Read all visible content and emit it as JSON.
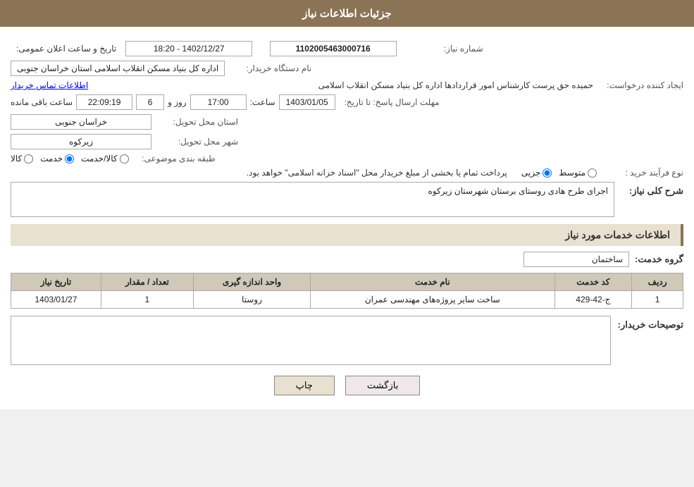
{
  "header": {
    "title": "جزئیات اطلاعات نیاز"
  },
  "info": {
    "need_number_label": "شماره نیاز:",
    "need_number_value": "1102005463000716",
    "announcement_label": "تاریخ و ساعت اعلان عمومی:",
    "announcement_value": "1402/12/27 - 18:20",
    "buyer_org_label": "نام دستگاه خریدار:",
    "buyer_org_value": "اداره کل بنیاد مسکن انقلاب اسلامی استان خراسان جنوبی",
    "creator_label": "ایجاد کننده درخواست:",
    "creator_value": "حمیده حق پرست کارشناس امور قراردادها اداره کل بنیاد مسکن انقلاب اسلامی",
    "contact_link": "اطلاعات تماس خریدار",
    "deadline_label": "مهلت ارسال پاسخ: تا تاریخ:",
    "deadline_date": "1403/01/05",
    "deadline_time_label": "ساعت:",
    "deadline_time": "17:00",
    "deadline_days_label": "روز و",
    "deadline_days": "6",
    "deadline_remaining_label": "ساعت باقی مانده",
    "deadline_remaining": "22:09:19",
    "province_label": "استان محل تحویل:",
    "province_value": "خراسان جنوبی",
    "city_label": "شهر محل تحویل:",
    "city_value": "زیرکوه",
    "category_label": "طبقه بندی موضوعی:",
    "category_options": [
      {
        "label": "کالا",
        "value": "kala"
      },
      {
        "label": "خدمت",
        "value": "khedmat"
      },
      {
        "label": "کالا/خدمت",
        "value": "kala_khedmat"
      }
    ],
    "category_selected": "khedmat",
    "purchase_type_label": "نوع فرآیند خرید :",
    "purchase_options": [
      {
        "label": "جزیی",
        "value": "jozii"
      },
      {
        "label": "متوسط",
        "value": "motavasset"
      }
    ],
    "purchase_selected": "jozii",
    "purchase_note": "پرداخت تمام یا بخشی از مبلغ خریدار محل \"اسناد خزانه اسلامی\" خواهد بود.",
    "need_description_label": "شرح کلی نیاز:",
    "need_description_value": "اجرای طرح هادی روستای برستان شهرستان زیرکوه"
  },
  "services": {
    "section_title": "اطلاعات خدمات مورد نیاز",
    "group_label": "گروه خدمت:",
    "group_value": "ساختمان",
    "table_headers": {
      "row_num": "ردیف",
      "service_code": "کد خدمت",
      "service_name": "نام خدمت",
      "unit": "واحد اندازه گیری",
      "quantity": "تعداد / مقدار",
      "date": "تاریخ نیاز"
    },
    "table_rows": [
      {
        "row_num": "1",
        "service_code": "ج-42-429",
        "service_name": "ساخت سایر پروژه‌های مهندسی عمران",
        "unit": "روستا",
        "quantity": "1",
        "date": "1403/01/27"
      }
    ]
  },
  "buyer_notes": {
    "label": "توصیحات خریدار:",
    "value": ""
  },
  "buttons": {
    "print": "چاپ",
    "back": "بازگشت"
  }
}
